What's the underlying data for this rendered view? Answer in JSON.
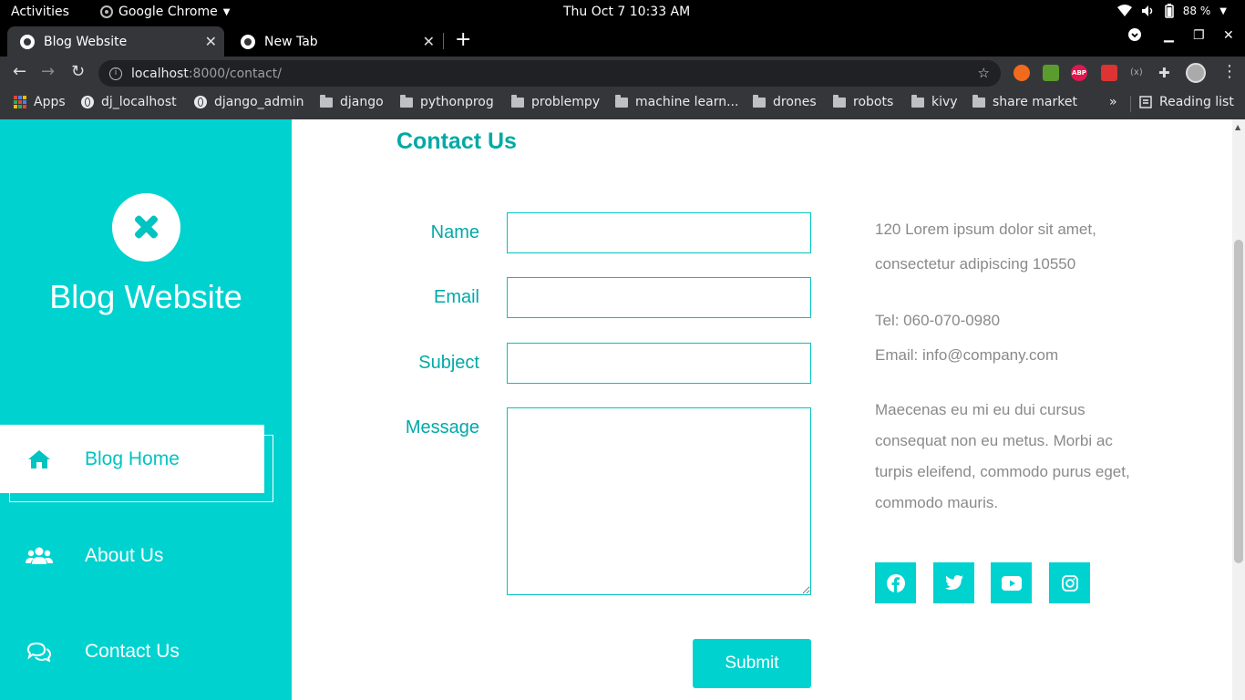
{
  "system": {
    "activities": "Activities",
    "app_name": "Google Chrome",
    "clock": "Thu Oct 7  10:33 AM",
    "battery": "88 %"
  },
  "browser": {
    "tabs": [
      {
        "label": "Blog Website"
      },
      {
        "label": "New Tab"
      }
    ],
    "url_host": "localhost",
    "url_rest": ":8000/contact/",
    "bookmarks": [
      "Apps",
      "dj_localhost",
      "django_admin",
      "django",
      "pythonprog",
      "problempy",
      "machine learn...",
      "drones",
      "robots",
      "kivy",
      "share market"
    ],
    "overflow": "»",
    "reading_list": "Reading list"
  },
  "sidebar": {
    "site_name": "Blog Website",
    "nav": [
      {
        "label": "Blog Home",
        "icon": "home-icon"
      },
      {
        "label": "About Us",
        "icon": "users-icon"
      },
      {
        "label": "Contact Us",
        "icon": "chat-icon"
      }
    ]
  },
  "contact": {
    "title": "Contact Us",
    "fields": {
      "name_label": "Name",
      "email_label": "Email",
      "subject_label": "Subject",
      "message_label": "Message"
    },
    "submit_label": "Submit",
    "address_line1": "120 Lorem ipsum dolor sit amet,",
    "address_line2": "consectetur adipiscing 10550",
    "tel": "Tel: 060-070-0980",
    "email": "Email: info@company.com",
    "paragraph": "Maecenas eu mi eu dui cursus consequat non eu metus. Morbi ac turpis eleifend, commodo purus eget, commodo mauris.",
    "social": [
      "facebook-icon",
      "twitter-icon",
      "youtube-icon",
      "instagram-icon"
    ]
  },
  "colors": {
    "accent": "#00d2d0",
    "accent_text": "#00a9a7",
    "muted_text": "#8a8a8a"
  }
}
